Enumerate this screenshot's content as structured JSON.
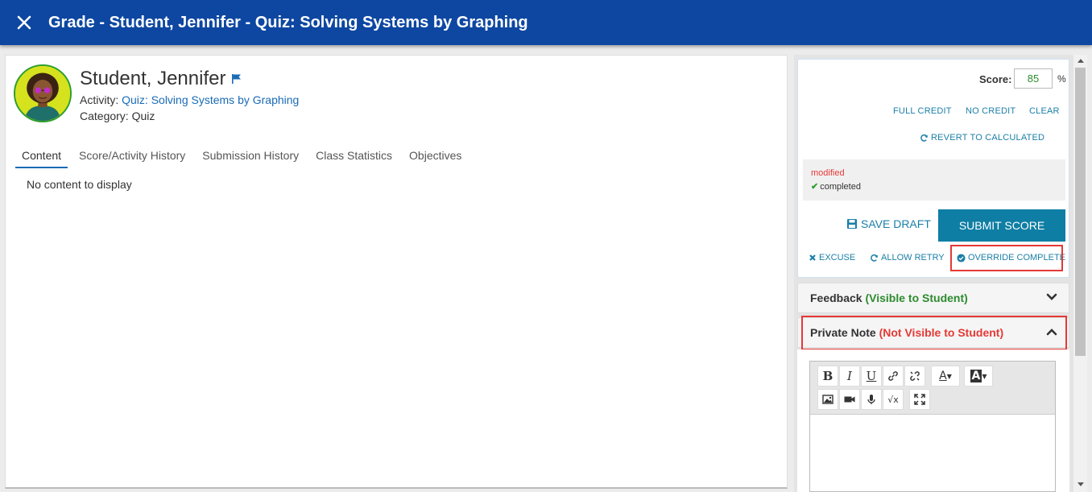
{
  "header": {
    "title": "Grade - Student, Jennifer - Quiz: Solving Systems by Graphing"
  },
  "student": {
    "name": "Student, Jennifer",
    "activity_label": "Activity:",
    "activity_link": "Quiz: Solving Systems by Graphing",
    "category": "Category: Quiz"
  },
  "tabs": [
    {
      "label": "Content"
    },
    {
      "label": "Score/Activity History"
    },
    {
      "label": "Submission History"
    },
    {
      "label": "Class Statistics"
    },
    {
      "label": "Objectives"
    }
  ],
  "content": {
    "empty_message": "No content to display"
  },
  "score": {
    "label": "Score:",
    "value": "85",
    "unit": "%",
    "full_credit": "FULL CREDIT",
    "no_credit": "NO CREDIT",
    "clear": "CLEAR",
    "revert": "REVERT TO CALCULATED",
    "status_modified": "modified",
    "status_completed": "completed",
    "save_draft": "SAVE DRAFT",
    "submit": "SUBMIT SCORE",
    "excuse": "EXCUSE",
    "allow_retry": "ALLOW RETRY",
    "override_complete": "OVERRIDE COMPLETE"
  },
  "feedback": {
    "title": "Feedback",
    "visibility": "(Visible to Student)"
  },
  "private_note": {
    "title": "Private Note",
    "visibility": "(Not Visible to Student)"
  },
  "colors": {
    "header_bg": "#0d47a1",
    "accent": "#0f7ea4",
    "link": "#1a6bb5",
    "highlight": "#e53935",
    "green": "#2e8b2e"
  }
}
